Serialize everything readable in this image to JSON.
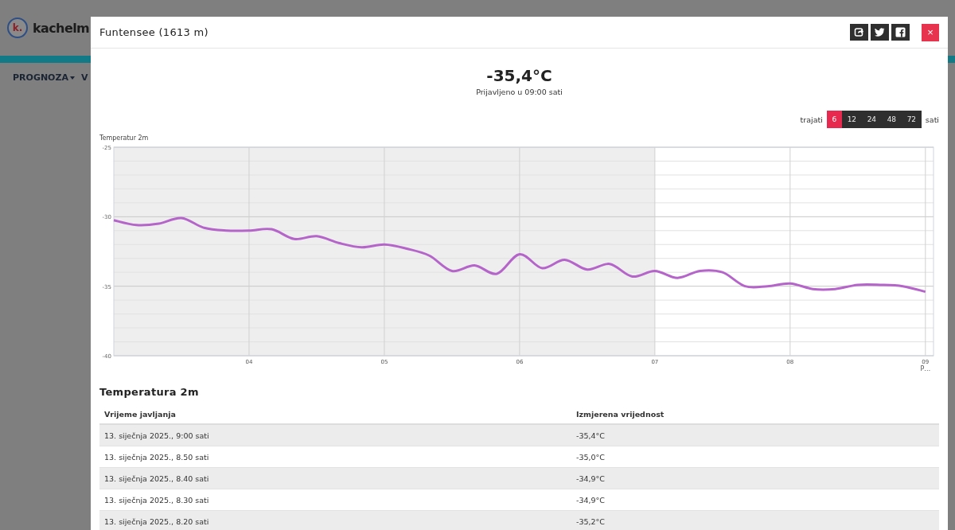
{
  "background_page": {
    "logo_mark": "k.",
    "logo_text": "kachelm",
    "nav_items": [
      {
        "label": "PROGNOZA",
        "dropdown": true
      },
      {
        "label": "V",
        "dropdown": false
      }
    ]
  },
  "window": {
    "title": "Funtensee (1613 m)",
    "close": "×"
  },
  "current": {
    "value": "-35,4°C",
    "reported": "Prijavljeno u 09:00 sati"
  },
  "duration": {
    "label": "trajati",
    "unit": "sati",
    "options": [
      {
        "label": "6",
        "selected": true
      },
      {
        "label": "12",
        "selected": false
      },
      {
        "label": "24",
        "selected": false
      },
      {
        "label": "48",
        "selected": false
      },
      {
        "label": "72",
        "selected": false
      }
    ]
  },
  "chart": {
    "chart_data": {
      "type": "line",
      "ylabel": "Temperatur 2m",
      "xlim": [
        3,
        9.06
      ],
      "ylim": [
        -40,
        -25
      ],
      "xticks": [
        {
          "value": 4,
          "label": "04"
        },
        {
          "value": 5,
          "label": "05"
        },
        {
          "value": 6,
          "label": "06"
        },
        {
          "value": 7,
          "label": "07"
        },
        {
          "value": 8,
          "label": "08"
        },
        {
          "value": 9,
          "label": "09"
        }
      ],
      "yticks": [
        -25,
        -30,
        -35,
        -40
      ],
      "x": [
        3.0,
        3.167,
        3.333,
        3.5,
        3.667,
        3.833,
        4.0,
        4.167,
        4.333,
        4.5,
        4.667,
        4.833,
        5.0,
        5.167,
        5.333,
        5.5,
        5.667,
        5.833,
        6.0,
        6.167,
        6.333,
        6.5,
        6.667,
        6.833,
        7.0,
        7.167,
        7.333,
        7.5,
        7.667,
        7.833,
        8.0,
        8.167,
        8.333,
        8.5,
        8.667,
        8.833,
        9.0
      ],
      "grid": true,
      "bands": [
        {
          "axis": "x",
          "from": 3,
          "to": 7
        }
      ],
      "series": [
        {
          "color": "#b565c9",
          "values": [
            -30.25,
            -30.6,
            -30.5,
            -30.1,
            -30.8,
            -31.0,
            -31.0,
            -30.9,
            -31.6,
            -31.4,
            -31.9,
            -32.2,
            -32.0,
            -32.3,
            -32.8,
            -33.9,
            -33.5,
            -34.1,
            -32.7,
            -33.7,
            -33.1,
            -33.8,
            -33.4,
            -34.3,
            -33.9,
            -34.4,
            -33.9,
            -34.0,
            -35.0,
            -35.0,
            -34.8,
            -35.2,
            -35.2,
            -34.9,
            -34.9,
            -35.0,
            -35.4
          ]
        }
      ],
      "annotations": [
        "P…"
      ]
    }
  },
  "table": {
    "title": "Temperatura 2m",
    "columns": [
      "Vrijeme javljanja",
      "Izmjerena vrijednost"
    ],
    "rows": [
      [
        "13. siječnja 2025., 9:00 sati",
        "-35,4°C"
      ],
      [
        "13. siječnja 2025., 8.50 sati",
        "-35,0°C"
      ],
      [
        "13. siječnja 2025., 8.40 sati",
        "-34,9°C"
      ],
      [
        "13. siječnja 2025., 8.30 sati",
        "-34,9°C"
      ],
      [
        "13. siječnja 2025., 8.20 sati",
        "-35,2°C"
      ]
    ]
  }
}
